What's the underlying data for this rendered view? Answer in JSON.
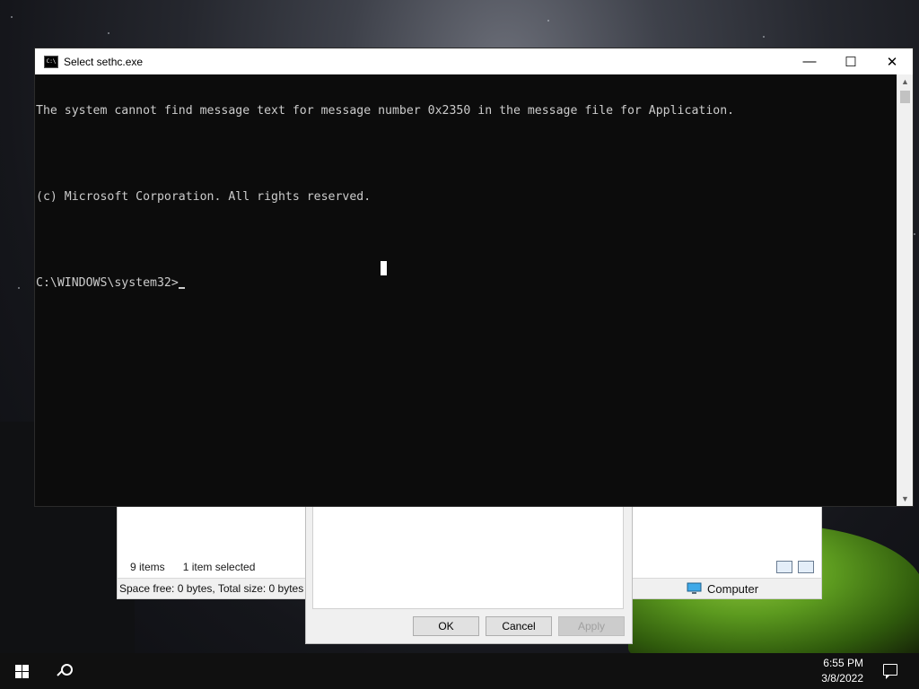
{
  "console": {
    "title": "Select sethc.exe",
    "icon": "console-icon",
    "lines": [
      "The system cannot find message text for message number 0x2350 in the message file for Application.",
      "",
      "(c) Microsoft Corporation. All rights reserved.",
      "",
      "C:\\WINDOWS\\system32>"
    ],
    "controls": {
      "minimize": "—",
      "maximize": "☐",
      "close": "✕"
    },
    "scroll": {
      "up": "▲",
      "down": "▼"
    }
  },
  "explorer": {
    "item_count": "9 items",
    "selection": "1 item selected",
    "space_info": "Space free: 0 bytes, Total size: 0 bytes",
    "location": "Computer"
  },
  "properties_dialog": {
    "ok": "OK",
    "cancel": "Cancel",
    "apply": "Apply"
  },
  "taskbar": {
    "time": "6:55 PM",
    "date": "3/8/2022"
  }
}
